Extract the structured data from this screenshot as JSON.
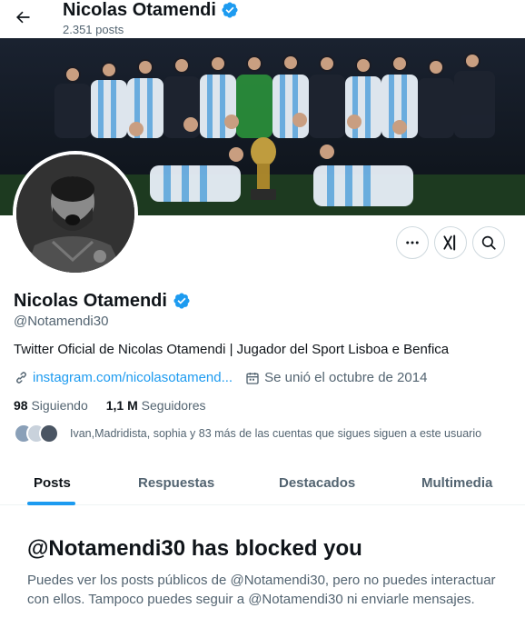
{
  "header": {
    "back_icon": "arrow-left-icon",
    "name": "Nicolas Otamendi",
    "post_count": "2.351 posts"
  },
  "banner": {
    "description_icon": "team-celebration-photo"
  },
  "profile": {
    "name": "Nicolas Otamendi",
    "handle": "@Notamendi30",
    "bio": "Twitter Oficial de Nicolas Otamendi | Jugador del Sport Lisboa e Benfica",
    "link": "instagram.com/nicolasotamend...",
    "joined": "Se unió el octubre de 2014",
    "following_count": "98",
    "following_label": "Siguiendo",
    "followers_count": "1,1 M",
    "followers_label": "Seguidores",
    "followed_by": "Ivan,Madridista, sophia y 83 más de las cuentas que sigues siguen a este usuario"
  },
  "tabs": [
    {
      "label": "Posts"
    },
    {
      "label": "Respuestas"
    },
    {
      "label": "Destacados"
    },
    {
      "label": "Multimedia"
    }
  ],
  "blocked": {
    "title": "@Notamendi30 has blocked you",
    "message": "Puedes ver los posts públicos de @Notamendi30, pero no puedes interactuar con ellos. Tampoco puedes seguir a @Notamendi30 ni enviarle mensajes."
  },
  "colors": {
    "accent": "#1d9bf0",
    "text": "#0f1419",
    "secondary": "#536471"
  }
}
